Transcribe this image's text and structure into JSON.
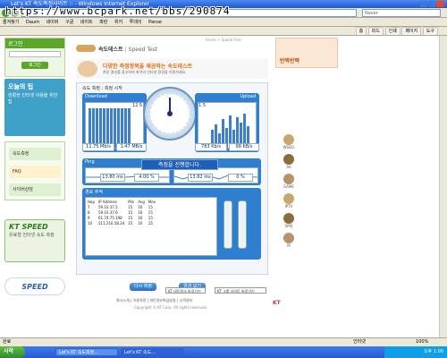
{
  "watermark": "https://www.bcpark.net/bbs/290874",
  "window": {
    "title": "Let's KT 속도측정사이트 :: - Windows Internet Explorer"
  },
  "search": {
    "placeholder": "Naver"
  },
  "toolbar": {
    "buttons": [
      "즐겨찾기",
      "Daum",
      "네이버",
      "구글",
      "네이트",
      "파란",
      "위키",
      "투데이",
      "Panse"
    ],
    "right": [
      "홈",
      "피드",
      "인쇄",
      "페이지",
      "도구"
    ]
  },
  "left": {
    "login_title": "로그인",
    "login_button": "로그인",
    "promo_title": "오늘의 팁",
    "promo_text": "원활한 인터넷 이용을 위한 팁",
    "menu": [
      "속도측정",
      "FAQ",
      "사이버상담"
    ],
    "kt_speed": "KT SPEED",
    "kt_speed_sub": "유료형 인터넷 속도 측정",
    "logo2": "SPEED"
  },
  "main": {
    "title": "속도테스트",
    "title_en": "Speed Test",
    "breadcrumb": "Home > Speed Test",
    "banner_title": "다양한 측정항목을 제공하는 속도테스트",
    "banner_sub": "측정 결과를 참고하여 최적의 인터넷 환경을 이용하세요.",
    "box_title": "속도 측정 : 측정 시작",
    "download_label": "Download",
    "upload_label": "Upload",
    "download_stats": [
      "11.75 Mb/s",
      "1.47 MB/s"
    ],
    "upload_stats": [
      "783 Kb/s",
      "98 KB/s"
    ],
    "gauge_left": "12.5",
    "gauge_right": "1.5",
    "ping_label": "Ping",
    "progress_text": "측정을 진행합니다.",
    "ping_stats": [
      "13.80 ms",
      "4.00 %"
    ],
    "ping_stats2": [
      "13.82 ms",
      "0 %"
    ],
    "trace_label": "경로 추적",
    "trace_headers": [
      "Hop",
      "IP Address",
      "Min",
      "Avg",
      "Max"
    ],
    "trace_rows": [
      [
        "7",
        "59.10.37.5",
        "15",
        "16",
        "15"
      ],
      [
        "8",
        "59.10.37.6",
        "15",
        "16",
        "15"
      ],
      [
        "9",
        "61.74.75.198",
        "15",
        "16",
        "15"
      ],
      [
        "10",
        "211.216.58.34",
        "15",
        "16",
        "15"
      ]
    ],
    "btn_retest": "다시 측정",
    "btn_result": "결과 보기"
  },
  "footer": {
    "links": "회사소개 | 이용약관 | 개인정보취급방침 | 고객센터",
    "copyright": "Copyright © KT Corp. All rights reserved.",
    "select1": "KT 네트워크 바로가기",
    "select2": "KT 그룹 사이트 바로가기"
  },
  "right": {
    "ad_text": "반짝반짝",
    "icons": [
      "WSDG",
      "Ad",
      "GAME",
      "IPTV",
      "SMS",
      "M"
    ]
  },
  "statusbar": {
    "text": "완료",
    "zone": "인터넷",
    "zoom": "100%"
  },
  "taskbar": {
    "start": "시작",
    "tasks": [
      "Let's KT 속도측정...",
      "Let's KT 속도..."
    ],
    "clock": "오후 1:00"
  }
}
